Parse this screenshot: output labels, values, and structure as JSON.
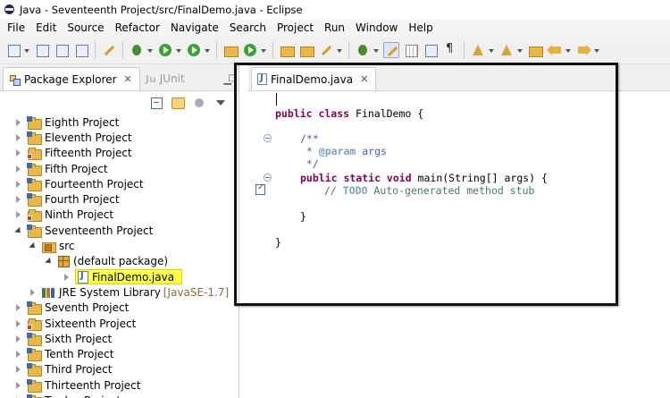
{
  "window": {
    "title": "Java - Seventeenth Project/src/FinalDemo.java - Eclipse"
  },
  "menubar": {
    "items": [
      "File",
      "Edit",
      "Source",
      "Refactor",
      "Navigate",
      "Search",
      "Project",
      "Run",
      "Window",
      "Help"
    ]
  },
  "toolbar": {
    "icons": [
      "new-icon",
      "save-icon",
      "save-all-icon",
      "print-icon",
      "skip-breakpoints-icon",
      "debug-icon",
      "run-icon",
      "external-tools-icon",
      "new-java-project-icon",
      "new-class-icon",
      "open-type-icon",
      "open-folder-icon",
      "search-icon",
      "next-annotation-icon",
      "mark-occurrences-icon",
      "block-selection-icon",
      "show-whitespace-icon",
      "back-icon",
      "forward-icon"
    ]
  },
  "package_explorer": {
    "tab_label": "Package Explorer",
    "junit_tab_label": "JUnit",
    "tree": [
      {
        "label": "Eighth Project",
        "type": "project",
        "state": "closed"
      },
      {
        "label": "Eleventh Project",
        "type": "project",
        "state": "closed"
      },
      {
        "label": "Fifteenth Project",
        "type": "project",
        "state": "closed"
      },
      {
        "label": "Fifth Project",
        "type": "project",
        "state": "closed"
      },
      {
        "label": "Fourteenth Project",
        "type": "project",
        "state": "closed"
      },
      {
        "label": "Fourth Project",
        "type": "project",
        "state": "closed"
      },
      {
        "label": "Ninth Project",
        "type": "project",
        "state": "closed"
      },
      {
        "label": "Seventeenth Project",
        "type": "project",
        "state": "open"
      },
      {
        "label": "src",
        "type": "source-folder",
        "state": "open"
      },
      {
        "label": "(default package)",
        "type": "package",
        "state": "open"
      },
      {
        "label": "FinalDemo.java",
        "type": "java-file",
        "state": "closed",
        "highlighted": true
      },
      {
        "label": "JRE System Library",
        "version": "[JavaSE-1.7]",
        "type": "library",
        "state": "closed"
      },
      {
        "label": "Seventh Project",
        "type": "project",
        "state": "closed"
      },
      {
        "label": "Sixteenth Project",
        "type": "project",
        "state": "closed"
      },
      {
        "label": "Sixth Project",
        "type": "project",
        "state": "closed"
      },
      {
        "label": "Tenth Project",
        "type": "project",
        "state": "closed"
      },
      {
        "label": "Third Project",
        "type": "project",
        "state": "closed"
      },
      {
        "label": "Thirteenth Project",
        "type": "project",
        "state": "closed"
      },
      {
        "label": "Twelve Project",
        "type": "project",
        "state": "closed"
      }
    ]
  },
  "editor": {
    "tab_label": "FinalDemo.java",
    "code": {
      "l2_kw": "public class",
      "l2_rest": " FinalDemo {",
      "l4": "/**",
      "l5_star": " * ",
      "l5_tag": "@param",
      "l5_rest": " args",
      "l6": " */",
      "l7_kw": "public static void",
      "l7_rest": " main(String[] args) {",
      "l8_prefix": "// ",
      "l8_todo": "TODO",
      "l8_rest": " Auto-generated method stub",
      "l10": "}",
      "l12": "}"
    }
  },
  "colors": {
    "keyword": "#7f0055",
    "javadoc": "#3f5fbf",
    "comment": "#3f7f5f",
    "highlight": "#ffff44"
  }
}
